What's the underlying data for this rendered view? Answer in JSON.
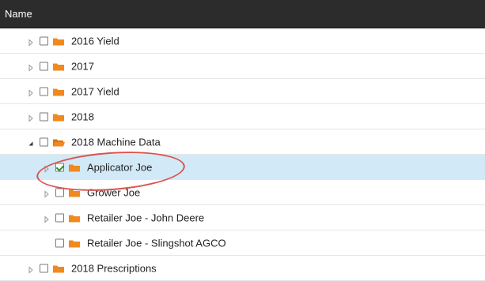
{
  "header": {
    "column_name": "Name"
  },
  "tree": [
    {
      "label": "2016 Yield",
      "level": 0,
      "toggle": "collapsed",
      "checked": false,
      "folder": "closed"
    },
    {
      "label": "2017",
      "level": 0,
      "toggle": "collapsed",
      "checked": false,
      "folder": "closed"
    },
    {
      "label": "2017 Yield",
      "level": 0,
      "toggle": "collapsed",
      "checked": false,
      "folder": "closed"
    },
    {
      "label": "2018",
      "level": 0,
      "toggle": "collapsed",
      "checked": false,
      "folder": "closed"
    },
    {
      "label": "2018 Machine Data",
      "level": 0,
      "toggle": "expanded",
      "checked": false,
      "folder": "open"
    },
    {
      "label": "Applicator Joe",
      "level": 1,
      "toggle": "collapsed",
      "checked": true,
      "folder": "closed",
      "selected": true
    },
    {
      "label": "Grower Joe",
      "level": 1,
      "toggle": "collapsed",
      "checked": false,
      "folder": "closed"
    },
    {
      "label": "Retailer Joe - John Deere",
      "level": 1,
      "toggle": "collapsed",
      "checked": false,
      "folder": "closed"
    },
    {
      "label": "Retailer Joe - Slingshot AGCO",
      "level": 1,
      "toggle": "none",
      "checked": false,
      "folder": "closed"
    },
    {
      "label": "2018 Prescriptions",
      "level": 0,
      "toggle": "collapsed",
      "checked": false,
      "folder": "closed"
    }
  ],
  "colors": {
    "header_bg": "#2c2c2c",
    "folder": "#f0891e",
    "selected_row": "#d2e9f7",
    "annotation": "#d9534f",
    "checkmark": "#2e8b2e"
  }
}
